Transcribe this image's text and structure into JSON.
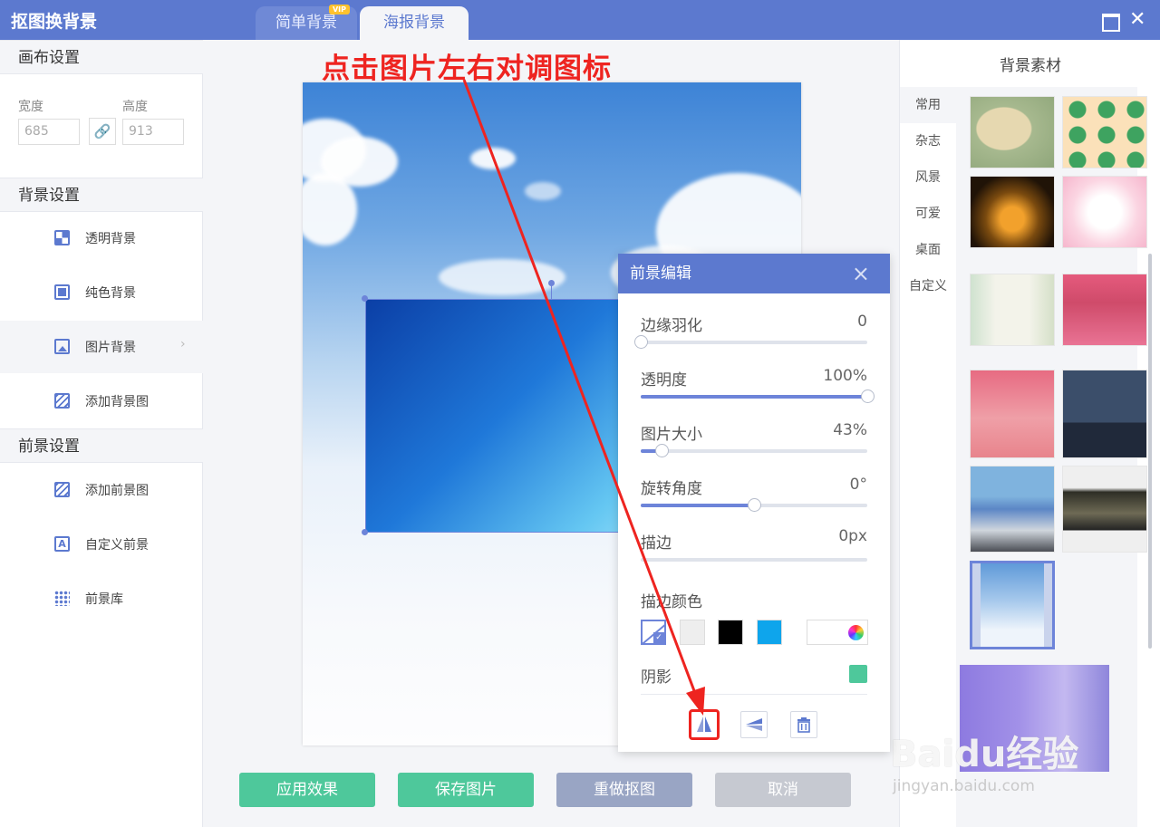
{
  "app": {
    "title": "抠图换背景"
  },
  "tabs": [
    {
      "label": "简单背景",
      "badge": "VIP"
    },
    {
      "label": "海报背景"
    }
  ],
  "left_panel": {
    "canvas_section": "画布设置",
    "width_label": "宽度",
    "height_label": "高度",
    "width_value": "685",
    "height_value": "913",
    "background_section": "背景设置",
    "background_items": [
      "透明背景",
      "纯色背景",
      "图片背景",
      "添加背景图"
    ],
    "foreground_section": "前景设置",
    "foreground_items": [
      "添加前景图",
      "自定义前景",
      "前景库"
    ]
  },
  "annotation": "点击图片左右对调图标",
  "actions": {
    "apply": "应用效果",
    "save": "保存图片",
    "redo": "重做抠图",
    "cancel": "取消"
  },
  "right_panel": {
    "title": "背景素材",
    "categories": [
      "常用",
      "杂志",
      "风景",
      "可爱",
      "桌面",
      "自定义"
    ],
    "selected_category": "常用"
  },
  "dialog": {
    "title": "前景编辑",
    "sliders": [
      {
        "label": "边缘羽化",
        "value": "0",
        "level": 0
      },
      {
        "label": "透明度",
        "value": "100%",
        "level": 1.0
      },
      {
        "label": "图片大小",
        "value": "43%",
        "level": 0.09
      },
      {
        "label": "旋转角度",
        "value": "0°",
        "level": 0.5
      },
      {
        "label": "描边",
        "value": "0px",
        "level": 0
      }
    ],
    "stroke_color_label": "描边颜色",
    "swatch_colors": [
      "#eeeeee",
      "#000000",
      "#0ea5ec"
    ],
    "shadow_label": "阴影",
    "shadow_color": "#4ec89b",
    "tools": [
      "flip-horizontal-icon",
      "flip-vertical-icon",
      "delete-icon"
    ]
  },
  "watermark": {
    "logo": "Baidu经验",
    "url": "jingyan.baidu.com"
  },
  "colors": {
    "accent": "#5c79cf",
    "green": "#4ec89b",
    "annotation": "#ee2420"
  }
}
